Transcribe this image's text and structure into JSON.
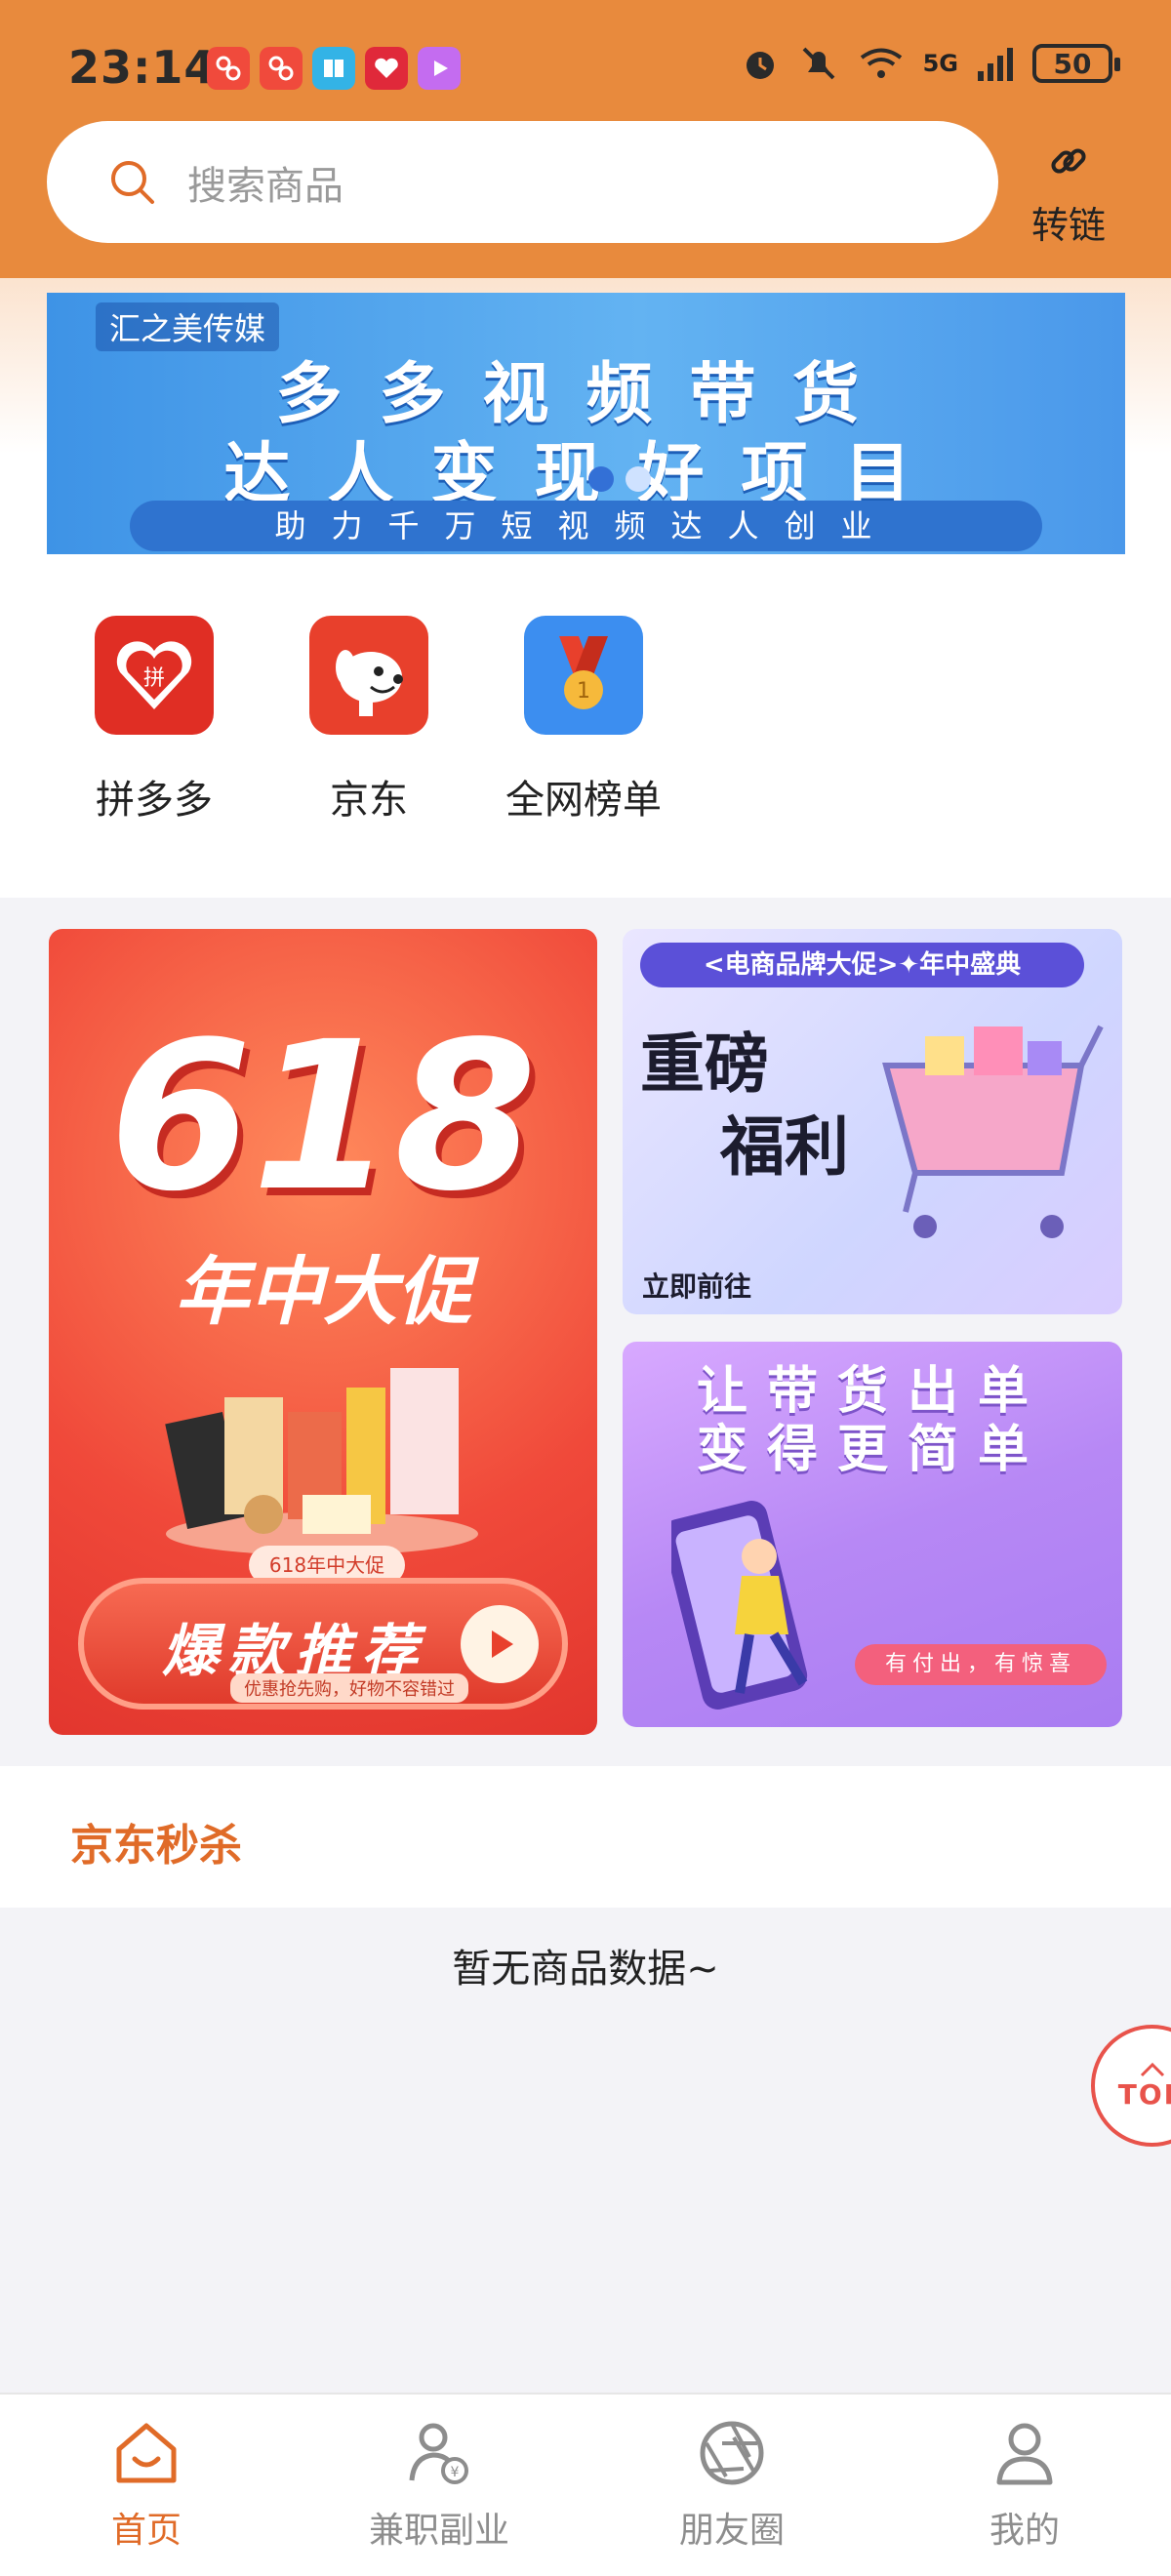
{
  "status_bar": {
    "time": "23:14",
    "battery": "50",
    "network": "5G",
    "app_icons": [
      "app-icon-1",
      "app-icon-2",
      "reader-icon",
      "heart-app-icon",
      "video-icon"
    ],
    "indicators": [
      "alarm-icon",
      "mute-icon",
      "wifi-icon",
      "signal-icon"
    ]
  },
  "header": {
    "search_placeholder": "搜索商品",
    "relink_label": "转链"
  },
  "banner": {
    "brand": "汇之美传媒",
    "line1": "多多视频带货",
    "line2": "达人变现好项目",
    "strip": "助力千万短视频达人创业",
    "active_slide": 1,
    "slide_count": 2
  },
  "categories": [
    {
      "label": "拼多多",
      "icon": "pinduoduo-icon",
      "color": "#e02e24"
    },
    {
      "label": "京东",
      "icon": "jd-dog-icon",
      "color": "#e8402c"
    },
    {
      "label": "全网榜单",
      "icon": "medal-icon",
      "color": "#3c8ef0"
    }
  ],
  "promos": {
    "p618": {
      "number": "618",
      "subtitle": "年中大促",
      "tag": "618年中大促",
      "button": "爆款推荐",
      "note": "优惠抢先购，好物不容错过"
    },
    "welfare": {
      "tag": "<电商品牌大促>✦年中盛典",
      "line_a": "重磅",
      "line_b": "福利",
      "go": "立即前往"
    },
    "deliver": {
      "line1": "让带货出单",
      "line2": "变得更简单",
      "footer": "有付出，有惊喜"
    }
  },
  "flash_sale": {
    "title": "京东秒杀",
    "empty_text": "暂无商品数据~"
  },
  "top_button": "TOP",
  "tabbar": [
    {
      "label": "首页",
      "icon": "home-icon",
      "active": true
    },
    {
      "label": "兼职副业",
      "icon": "side-job-icon",
      "active": false
    },
    {
      "label": "朋友圈",
      "icon": "aperture-icon",
      "active": false
    },
    {
      "label": "我的",
      "icon": "profile-icon",
      "active": false
    }
  ],
  "colors": {
    "header": "#e88a3d",
    "accent": "#e06b28",
    "top_button": "#e8534b"
  }
}
